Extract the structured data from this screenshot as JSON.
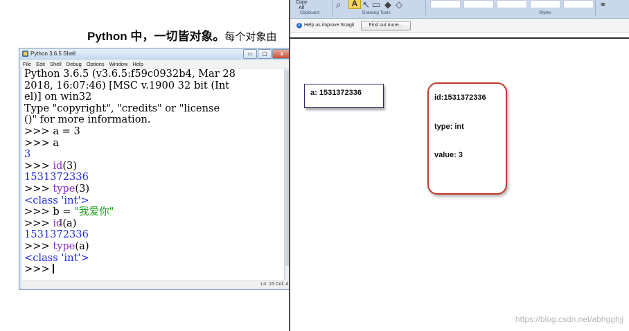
{
  "heading": {
    "text": "Python 中，一切皆对象。",
    "tail": "每个对象由"
  },
  "shell": {
    "title": "Python 3.6.5 Shell",
    "window_buttons": {
      "minimize": "▭",
      "maximize": "▢",
      "close": "x"
    },
    "menu": [
      "File",
      "Edit",
      "Shell",
      "Debug",
      "Options",
      "Window",
      "Help"
    ],
    "banner": [
      "Python 3.6.5 (v3.6.5:f59c0932b4, Mar 28",
      "2018, 16:07:46) [MSC v.1900 32 bit (Int",
      "el)] on win32",
      "Type \"copyright\", \"credits\" or \"license",
      "()\" for more information."
    ],
    "prompt": ">>>",
    "lines": {
      "cmd1": "a = 3",
      "cmd2": "a",
      "out2": "3",
      "cmd3_fn": "id",
      "cmd3_arg": "(3)",
      "out3": "1531372336",
      "cmd4_fn": "type",
      "cmd4_arg": "(3)",
      "out4": "<class 'int'>",
      "cmd5_pre": "b = ",
      "cmd5_str": "\"我爱你\"",
      "cmd6_fn": "id",
      "cmd6_arg": "(a)",
      "out6": "1531372336",
      "cmd7_fn": "type",
      "cmd7_arg": "(a)",
      "out7": "<class 'int'>"
    },
    "ibeam": "I",
    "status": "Ln: 15   Col: 4"
  },
  "snagit": {
    "ribbon": {
      "copy_all": "Copy\nAll",
      "clipboard_label": "Clipboard",
      "drawing_tools_label": "Drawing Tools",
      "styles_label": "Styles",
      "text_tool": "A"
    },
    "infobar": {
      "message": "Help us improve Snagit",
      "button": "Find out more..."
    }
  },
  "diagram": {
    "variable_box": "a: 1531372336",
    "object_id": "id:1531372336",
    "object_type": "type: int",
    "object_value": "value:  3"
  },
  "watermark": "https://blog.csdn.net/abhgghjj",
  "colors": {
    "keyword_blue": "#1f2bd8",
    "builtin_purple": "#8a2fc4",
    "string_green": "#22a022",
    "object_border": "#c0392b"
  }
}
